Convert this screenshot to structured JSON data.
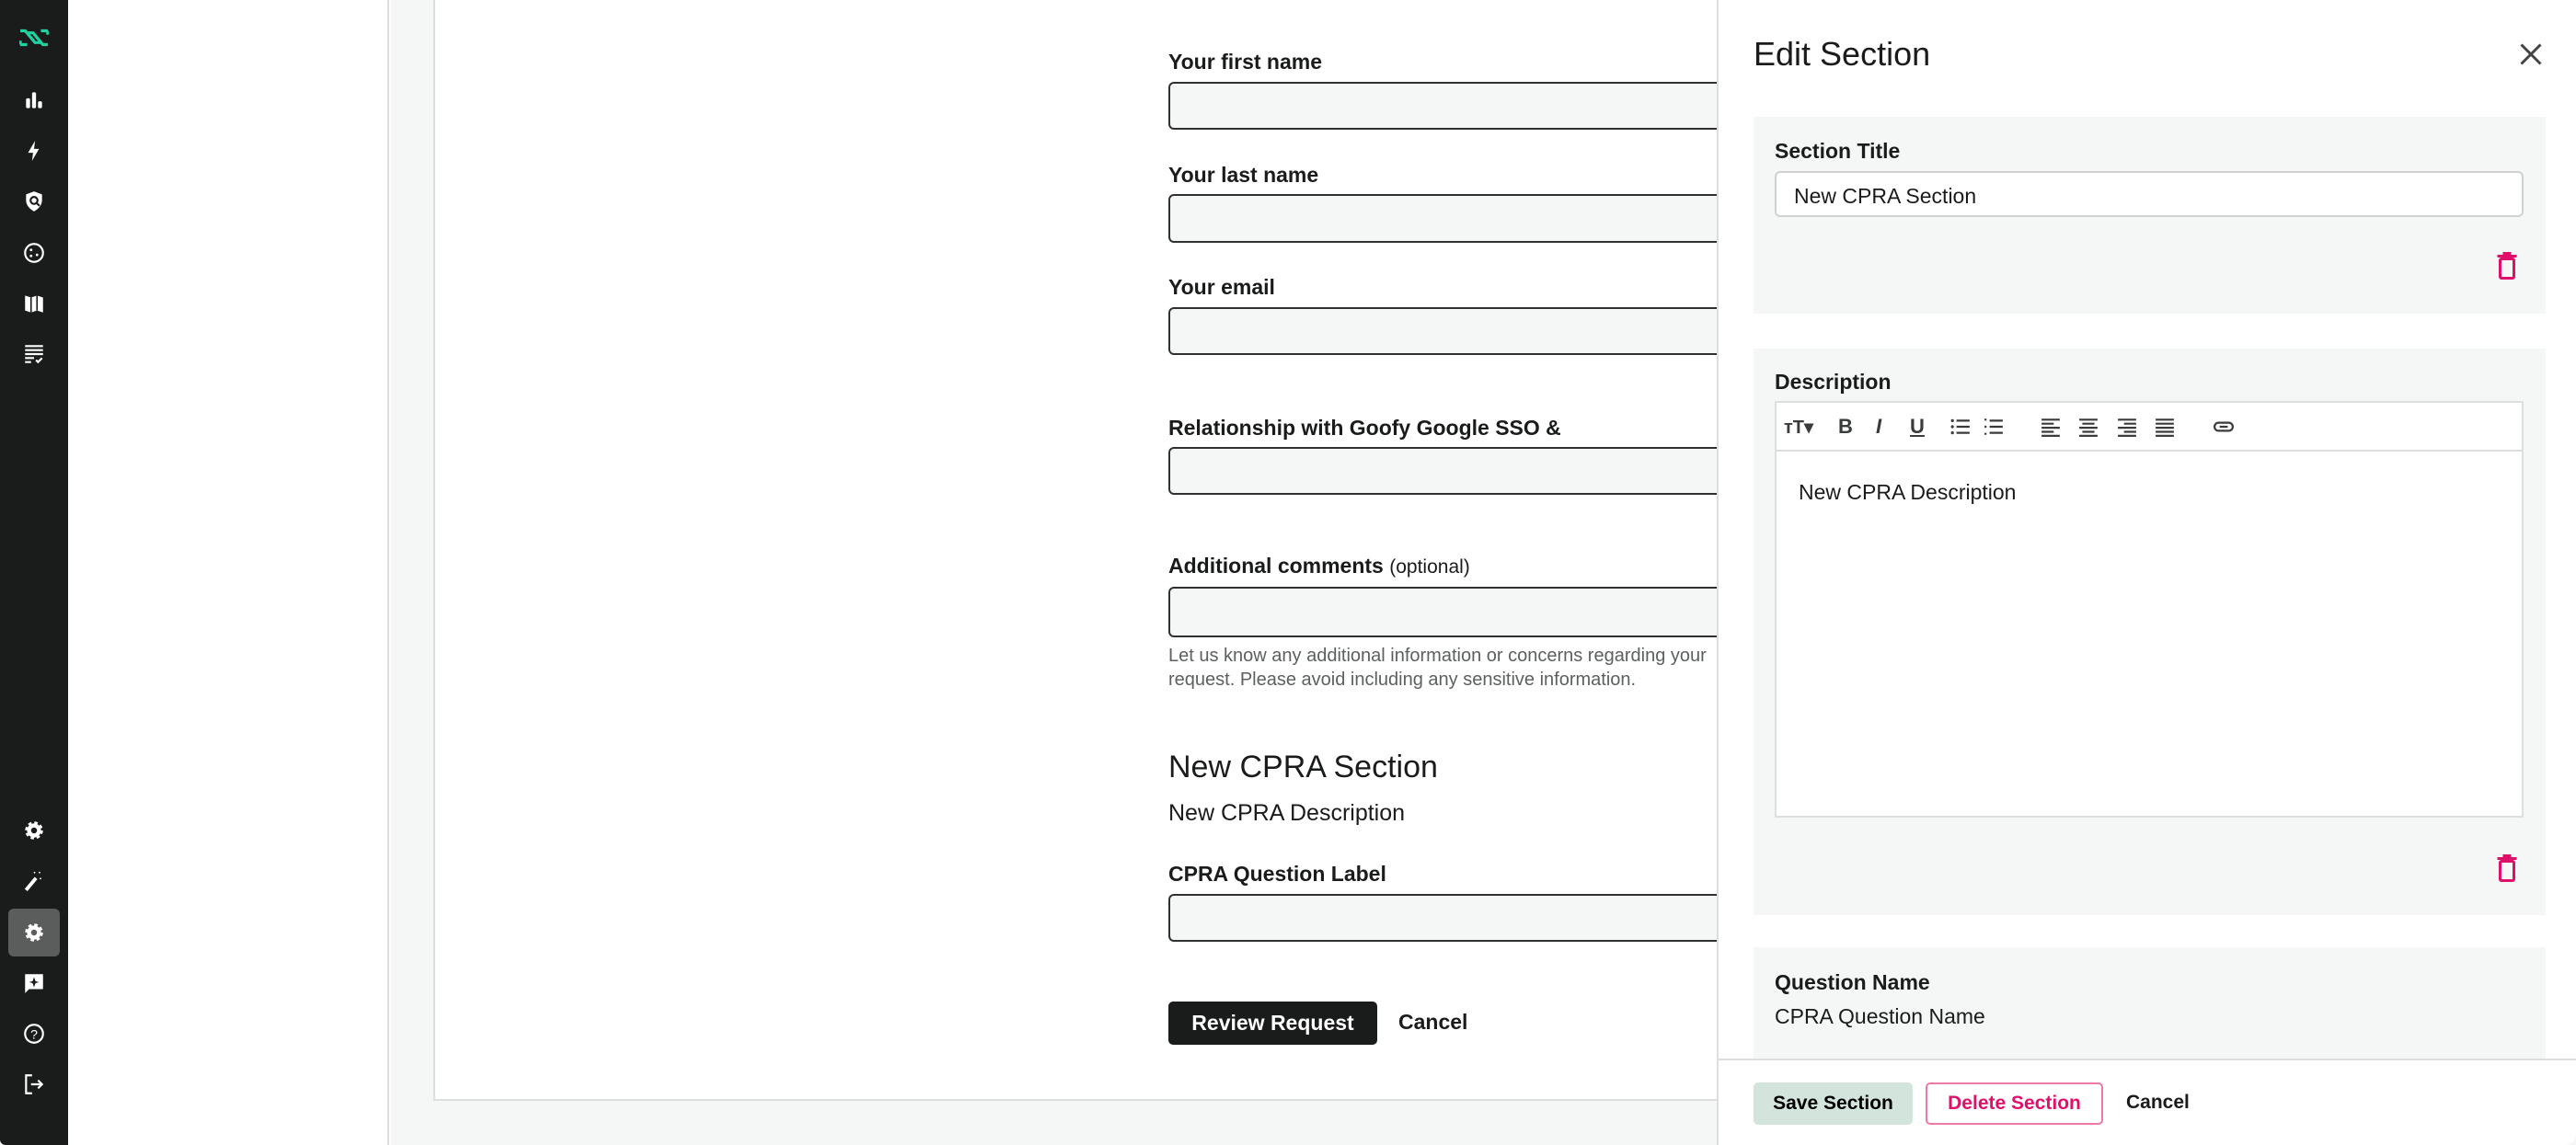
{
  "sidebar": {
    "logo_color": "#1fd3a0",
    "top_icons": [
      "chart-bar-icon",
      "lightning-icon",
      "shield-search-icon",
      "cookie-icon",
      "map-icon",
      "list-check-icon"
    ],
    "bottom_icons": [
      "gear-icon",
      "magic-wand-icon",
      "settings-icon",
      "feedback-icon",
      "help-icon",
      "logout-icon"
    ],
    "active": "settings-icon"
  },
  "form": {
    "first_name_label": "Your first name",
    "last_name_label": "Your last name",
    "email_label": "Your email",
    "relationship_label": "Relationship with Goofy Google SSO &",
    "comments_label": "Additional comments",
    "comments_optional": "(optional)",
    "comments_help": "Let us know any additional information or concerns regarding your request. Please avoid including any sensitive information.",
    "section_title": "New CPRA Section",
    "section_description": "New CPRA Description",
    "question_label": "CPRA Question Label",
    "review_button": "Review Request",
    "cancel_button": "Cancel"
  },
  "drawer": {
    "title": "Edit Section",
    "section_title_label": "Section Title",
    "section_title_value": "New CPRA Section",
    "description_label": "Description",
    "description_value": "New CPRA Description",
    "toolbar": [
      "font-size-icon",
      "bold-icon",
      "italic-icon",
      "underline-icon",
      "bullet-list-icon",
      "numbered-list-icon",
      "align-left-icon",
      "align-center-icon",
      "align-right-icon",
      "align-justify-icon",
      "link-icon"
    ],
    "question_name_label": "Question Name",
    "question_name_value": "CPRA Question Name",
    "save_button": "Save Section",
    "delete_button": "Delete Section",
    "cancel_button": "Cancel",
    "danger_color": "#e0106a"
  }
}
